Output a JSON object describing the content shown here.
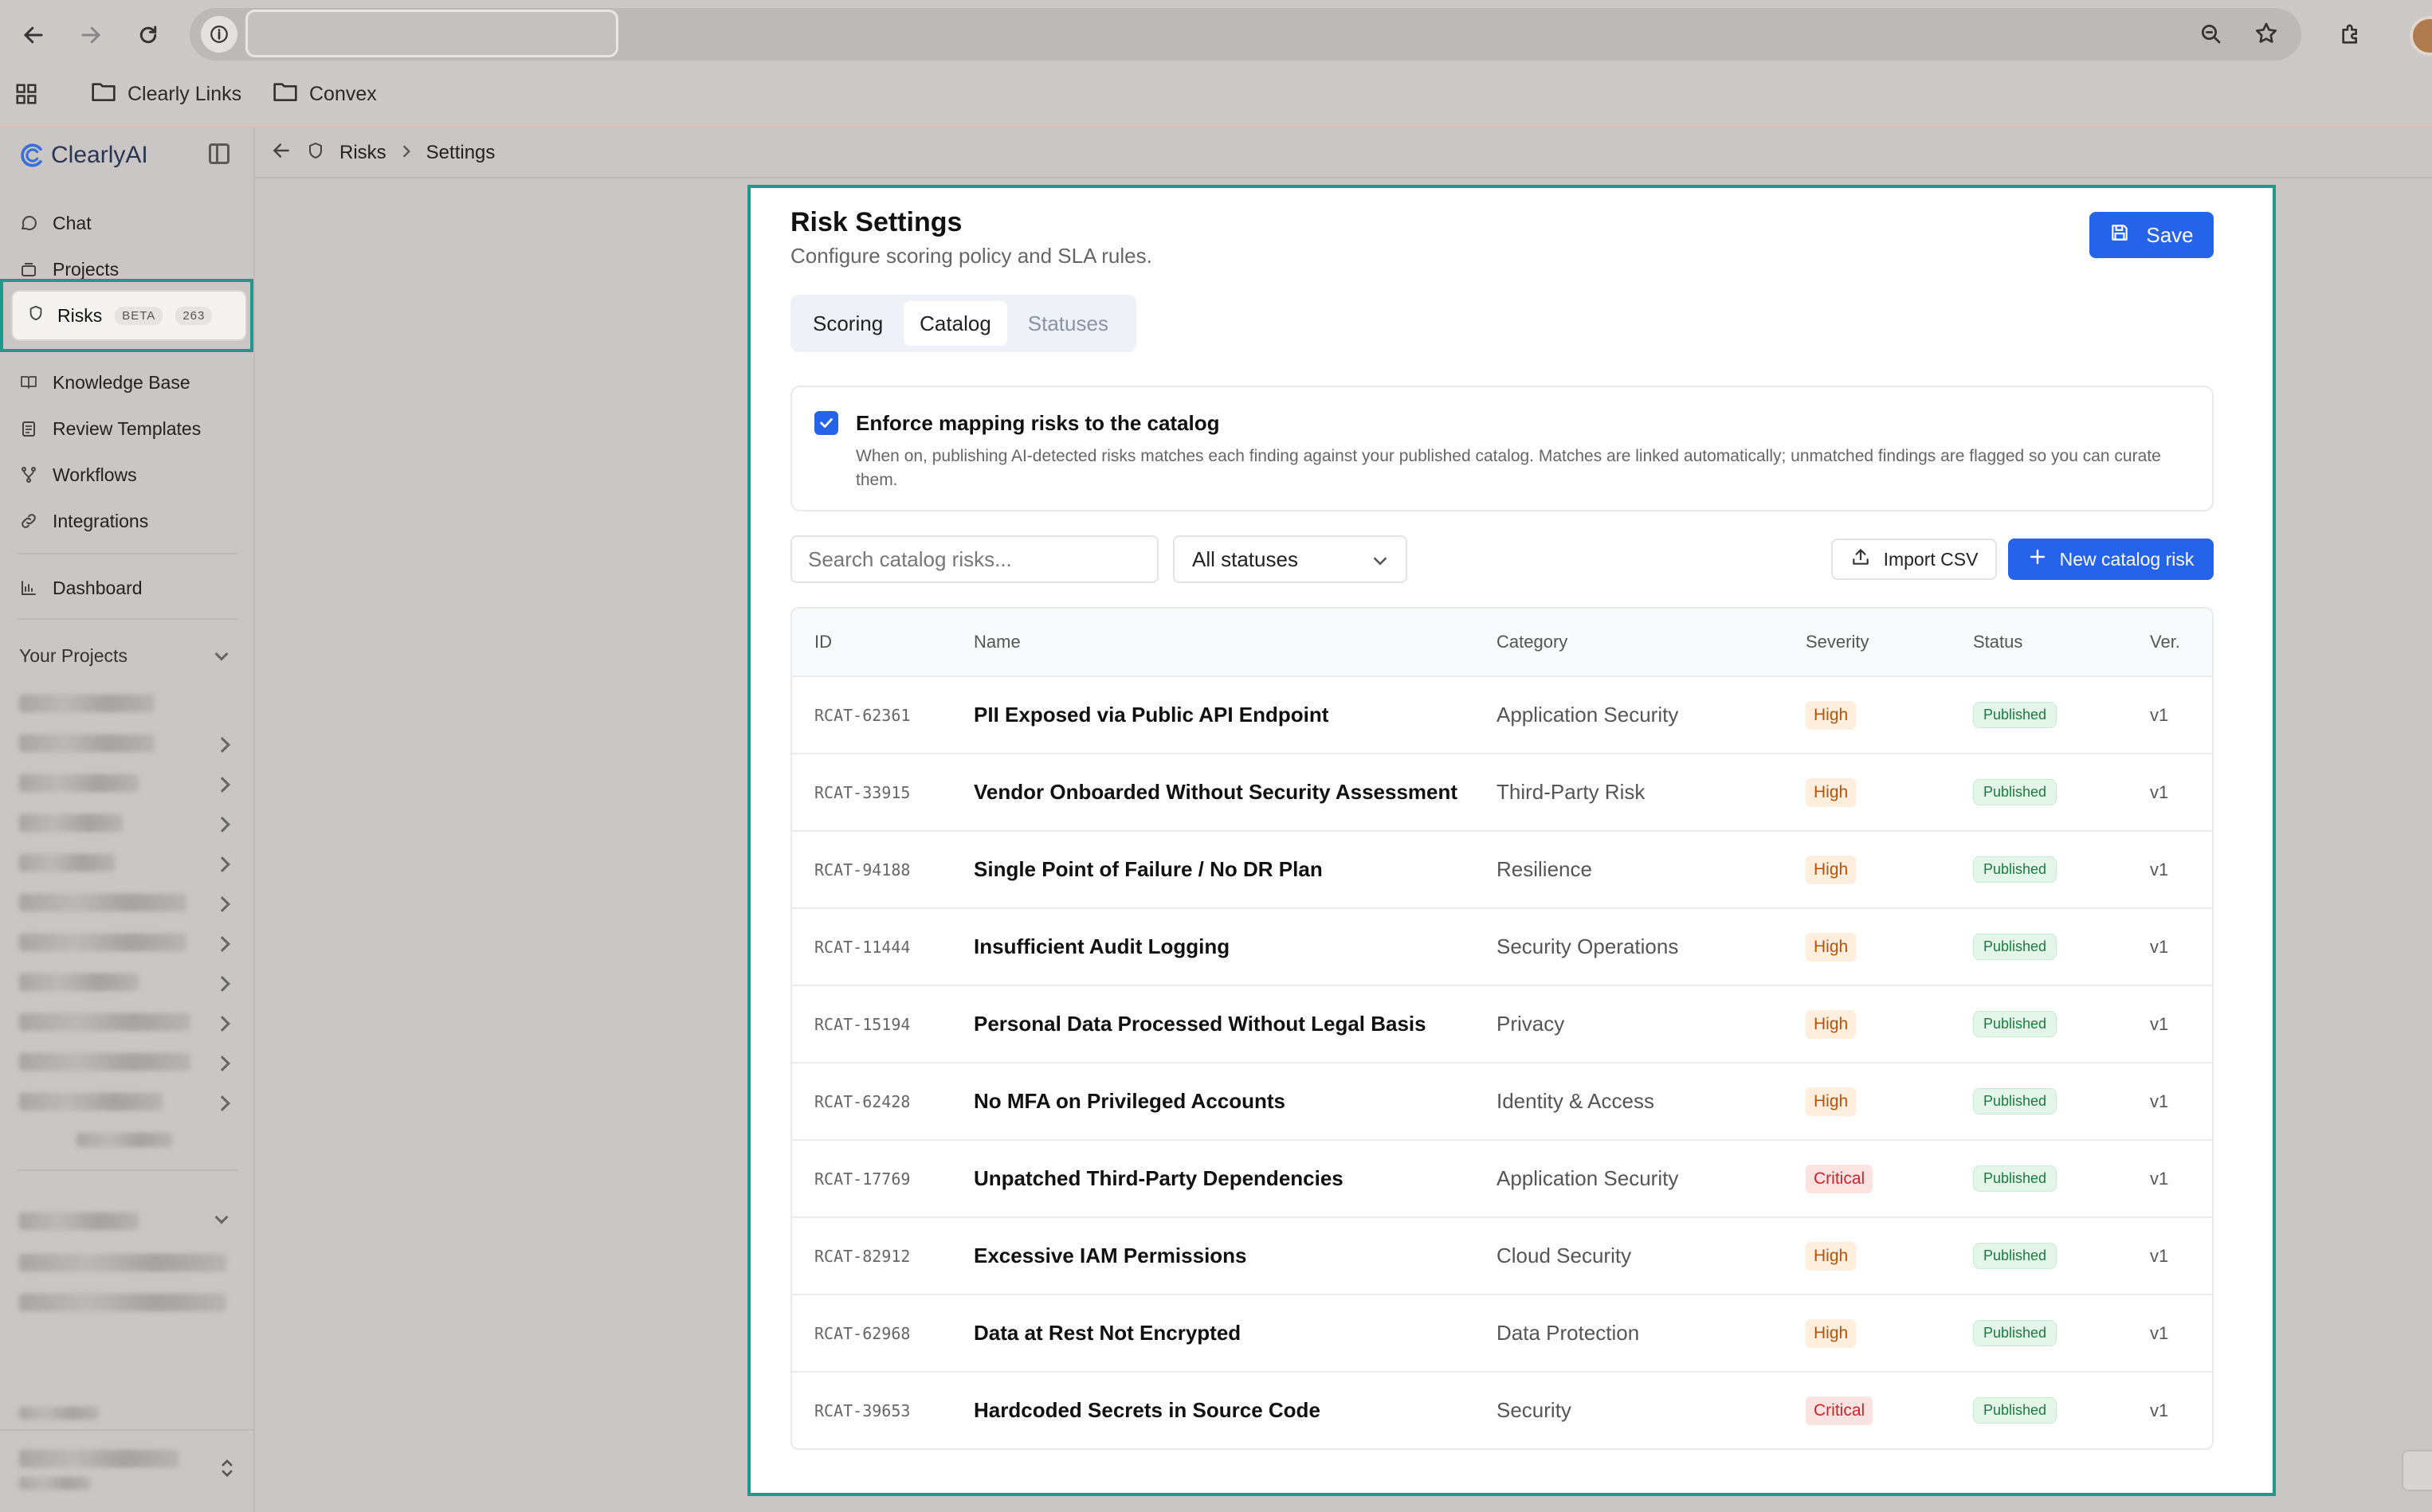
{
  "browser": {
    "bookmarks": [
      {
        "label": "Clearly Links"
      },
      {
        "label": "Convex"
      }
    ]
  },
  "sidebar": {
    "logo": "ClearlyAI",
    "nav": [
      {
        "label": "Chat",
        "icon": "chat-icon"
      },
      {
        "label": "Projects",
        "icon": "projects-icon"
      }
    ],
    "risks": {
      "label": "Risks",
      "badge": "BETA",
      "count": "263"
    },
    "nav2": [
      {
        "label": "Knowledge Base",
        "icon": "book-icon"
      },
      {
        "label": "Review Templates",
        "icon": "template-icon"
      },
      {
        "label": "Workflows",
        "icon": "workflow-icon"
      },
      {
        "label": "Integrations",
        "icon": "link-icon"
      }
    ],
    "dashboard": {
      "label": "Dashboard",
      "icon": "chart-icon"
    },
    "your_projects": "Your Projects"
  },
  "breadcrumb": {
    "parent": "Risks",
    "current": "Settings"
  },
  "page": {
    "title": "Risk Settings",
    "subtitle": "Configure scoring policy and SLA rules.",
    "save_label": "Save"
  },
  "tabs": [
    {
      "label": "Scoring",
      "state": "normal"
    },
    {
      "label": "Catalog",
      "state": "active"
    },
    {
      "label": "Statuses",
      "state": "muted"
    }
  ],
  "enforce": {
    "checked": true,
    "title": "Enforce mapping risks to the catalog",
    "description": "When on, publishing AI-detected risks matches each finding against your published catalog. Matches are linked automatically; unmatched findings are flagged so you can curate them."
  },
  "toolbar": {
    "search_placeholder": "Search catalog risks...",
    "status_filter": "All statuses",
    "import_label": "Import CSV",
    "new_label": "New catalog risk"
  },
  "table": {
    "headers": {
      "id": "ID",
      "name": "Name",
      "category": "Category",
      "severity": "Severity",
      "status": "Status",
      "version": "Ver."
    },
    "rows": [
      {
        "id": "RCAT-62361",
        "name": "PII Exposed via Public API Endpoint",
        "category": "Application Security",
        "severity": "High",
        "status": "Published",
        "version": "v1"
      },
      {
        "id": "RCAT-33915",
        "name": "Vendor Onboarded Without Security Assessment",
        "category": "Third-Party Risk",
        "severity": "High",
        "status": "Published",
        "version": "v1"
      },
      {
        "id": "RCAT-94188",
        "name": "Single Point of Failure / No DR Plan",
        "category": "Resilience",
        "severity": "High",
        "status": "Published",
        "version": "v1"
      },
      {
        "id": "RCAT-11444",
        "name": "Insufficient Audit Logging",
        "category": "Security Operations",
        "severity": "High",
        "status": "Published",
        "version": "v1"
      },
      {
        "id": "RCAT-15194",
        "name": "Personal Data Processed Without Legal Basis",
        "category": "Privacy",
        "severity": "High",
        "status": "Published",
        "version": "v1"
      },
      {
        "id": "RCAT-62428",
        "name": "No MFA on Privileged Accounts",
        "category": "Identity & Access",
        "severity": "High",
        "status": "Published",
        "version": "v1"
      },
      {
        "id": "RCAT-17769",
        "name": "Unpatched Third-Party Dependencies",
        "category": "Application Security",
        "severity": "Critical",
        "status": "Published",
        "version": "v1"
      },
      {
        "id": "RCAT-82912",
        "name": "Excessive IAM Permissions",
        "category": "Cloud Security",
        "severity": "High",
        "status": "Published",
        "version": "v1"
      },
      {
        "id": "RCAT-62968",
        "name": "Data at Rest Not Encrypted",
        "category": "Data Protection",
        "severity": "High",
        "status": "Published",
        "version": "v1"
      },
      {
        "id": "RCAT-39653",
        "name": "Hardcoded Secrets in Source Code",
        "category": "Security",
        "severity": "Critical",
        "status": "Published",
        "version": "v1"
      }
    ]
  },
  "colors": {
    "accent": "#2563eb",
    "highlight_outline": "#1d9b8a"
  }
}
